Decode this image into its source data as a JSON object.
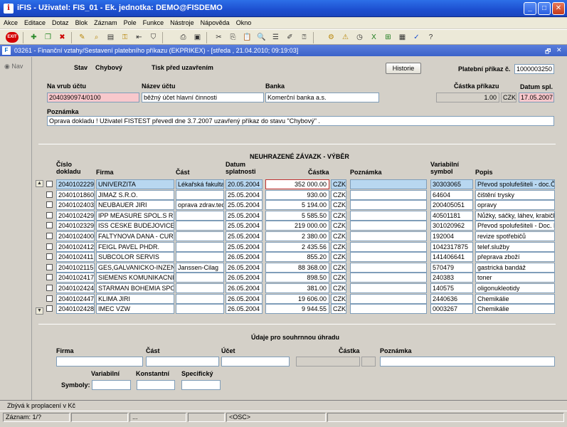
{
  "window": {
    "title": "iFIS - Uživatel: FIS_01 - Ek. jednotka: DEMO@FISDEMO",
    "buttons": {
      "minimize": "_",
      "maximize": "□",
      "close": "✕"
    }
  },
  "menu": [
    "Akce",
    "Editace",
    "Dotaz",
    "Blok",
    "Záznam",
    "Pole",
    "Funkce",
    "Nástroje",
    "Nápověda",
    "Okno"
  ],
  "toolbar": {
    "exit_label": "EXIT"
  },
  "form_window": {
    "icon_label": "F",
    "title": "03261 - Finanční vztahy/Sestavení platebního příkazu (EKPRIKEX) - [středa , 21.04.2010; 09:19:03]",
    "controls": [
      "🗗",
      "✕"
    ]
  },
  "nav": {
    "label": "Nav"
  },
  "header": {
    "stav_label": "Stav",
    "stav_value": "Chybový",
    "tisk_label": "Tisk před uzavřením",
    "historie_button": "Historie",
    "platebni_prikaz_label": "Platební příkaz č.",
    "platebni_prikaz_value": "1000003250",
    "na_vrub_uctu_label": "Na vrub účtu",
    "na_vrub_uctu_value": "2040390974/0100",
    "nazev_uctu_label": "Název účtu",
    "nazev_uctu_value": "běžný účet hlavní činnosti",
    "banka_label": "Banka",
    "banka_value": "Komerční banka a.s.",
    "castka_prikazu_label": "Částka příkazu",
    "castka_prikazu_value": "1.00",
    "mena_value": "CZK",
    "datum_spl_label": "Datum spl.",
    "datum_spl_value": "17.05.2007",
    "poznamka_label": "Poznámka",
    "poznamka_value": "Oprava dokladu ! Uživatel FISTEST převedl dne 3.7.2007 uzavřený příkaz do stavu \"Chybový\" ."
  },
  "grid": {
    "title": "NEUHRAZENÉ ZÁVAZK - VÝBĚR",
    "columns": {
      "cislo_dokladu": "Číslo dokladu",
      "firma": "Firma",
      "cast": "Část",
      "datum_splatnosti": "Datum splatnosti",
      "castka": "Částka",
      "poznamka": "Poznámka",
      "variabilni_symbol": "Variabilní symbol",
      "popis": "Popis"
    },
    "rows": [
      {
        "doklad": "2040102229",
        "firma": "UNIVERZITA",
        "cast": "Lékařská fakulta",
        "datum": "20.05.2004",
        "castka": "352 000.00",
        "mena": "CZK",
        "poznamka": "",
        "vs": "30303065",
        "popis": "Převod spolufešiteli - doc.Čer"
      },
      {
        "doklad": "2040101860",
        "firma": "JIMAZ S.R.O.",
        "cast": "",
        "datum": "25.05.2004",
        "castka": "930.00",
        "mena": "CZK",
        "poznamka": "",
        "vs": "64604",
        "popis": "čištění trysky"
      },
      {
        "doklad": "2040102403",
        "firma": "NEUBAUER JIRI",
        "cast": "oprava zdrav.tech",
        "datum": "25.05.2004",
        "castka": "5 194.00",
        "mena": "CZK",
        "poznamka": "",
        "vs": "200405051",
        "popis": "opravy"
      },
      {
        "doklad": "2040102429",
        "firma": "IPP MEASURE SPOL.S R",
        "cast": "",
        "datum": "25.05.2004",
        "castka": "5 585.50",
        "mena": "CZK",
        "poznamka": "",
        "vs": "40501181",
        "popis": "Nůžky, sáčky, láhev, krabičky"
      },
      {
        "doklad": "2040102329",
        "firma": "ISS CESKE BUDEJOVICE",
        "cast": "",
        "datum": "25.05.2004",
        "castka": "219 000.00",
        "mena": "CZK",
        "poznamka": "",
        "vs": "301020962",
        "popis": "Převod spolufešiteli - Doc. M"
      },
      {
        "doklad": "2040102400",
        "firma": "FALTYNOVA DANA - CUR",
        "cast": "",
        "datum": "25.05.2004",
        "castka": "2 380.00",
        "mena": "CZK",
        "poznamka": "",
        "vs": "192004",
        "popis": "revize spotřebičů"
      },
      {
        "doklad": "2040102412",
        "firma": "FEIGL PAVEL PHDR.",
        "cast": "",
        "datum": "25.05.2004",
        "castka": "2 435.56",
        "mena": "CZK",
        "poznamka": "",
        "vs": "1042317875",
        "popis": "telef.služby"
      },
      {
        "doklad": "2040102411",
        "firma": "SUBCOLOR SERVIS",
        "cast": "",
        "datum": "26.05.2004",
        "castka": "855.20",
        "mena": "CZK",
        "poznamka": "",
        "vs": "141406641",
        "popis": "přeprava zboží"
      },
      {
        "doklad": "2040102115",
        "firma": "GES,GALVANICKO-INZEN",
        "cast": "Janssen-Cilag",
        "datum": "26.05.2004",
        "castka": "88 368.00",
        "mena": "CZK",
        "poznamka": "",
        "vs": "570479",
        "popis": "gastrická bandáž"
      },
      {
        "doklad": "2040102417",
        "firma": "SIEMENS KOMUNIKACNI",
        "cast": "",
        "datum": "26.05.2004",
        "castka": "898.50",
        "mena": "CZK",
        "poznamka": "",
        "vs": "240383",
        "popis": "toner"
      },
      {
        "doklad": "2040102424",
        "firma": "STARMAN BOHEMIA SPOL",
        "cast": "",
        "datum": "26.05.2004",
        "castka": "381.00",
        "mena": "CZK",
        "poznamka": "",
        "vs": "140575",
        "popis": "oligonukleotidy"
      },
      {
        "doklad": "2040102447",
        "firma": "KLIMA JIRI",
        "cast": "",
        "datum": "26.05.2004",
        "castka": "19 606.00",
        "mena": "CZK",
        "poznamka": "",
        "vs": "2440636",
        "popis": "Chemikálie"
      },
      {
        "doklad": "2040102428",
        "firma": "IMEC VZW",
        "cast": "",
        "datum": "26.05.2004",
        "castka": "9 944.55",
        "mena": "CZK",
        "poznamka": "",
        "vs": "0003267",
        "popis": "Chemikálie"
      }
    ]
  },
  "summary": {
    "title": "Údaje pro souhrnnou úhradu",
    "firma_label": "Firma",
    "cast_label": "Část",
    "ucet_label": "Účet",
    "castka_label": "Částka",
    "poznamka_label": "Poznámka",
    "symboly_label": "Symboly:",
    "variabilni_label": "Variabilní",
    "konstantni_label": "Konstantní",
    "specificky_label": "Specifický"
  },
  "status": {
    "message": "Zbývá k proplacení v Kč",
    "record": "Záznam: 1/?",
    "cell3": "...",
    "osc": "<OSC>"
  },
  "colors": {
    "titlebar": "#1d4fd0",
    "selected_row": "#b8d7f0",
    "error_field": "#f8c8cc"
  }
}
